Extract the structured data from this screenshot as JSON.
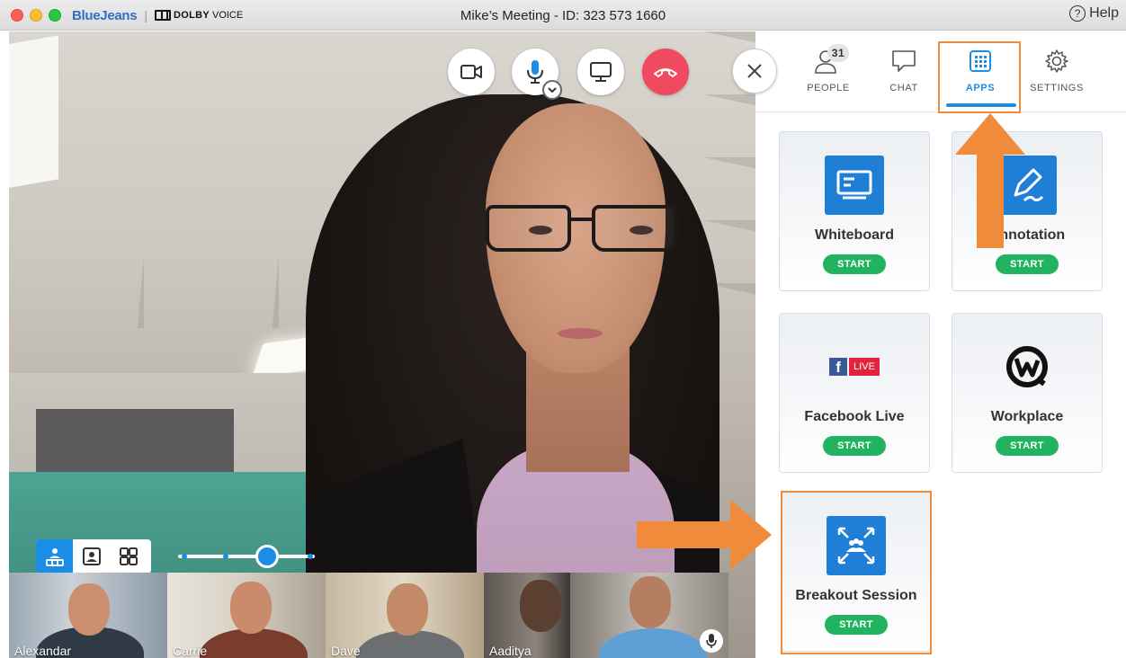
{
  "window": {
    "brand": "BlueJeans",
    "separator": "|",
    "dolby": "DOLBY",
    "dolby_voice": "VOICE",
    "title": "Mike’s Meeting - ID: 323 573 1660",
    "help_label": "Help"
  },
  "controls": {
    "video_icon": "video-camera-icon",
    "mic_icon": "microphone-icon",
    "share_icon": "screen-share-icon",
    "hangup_icon": "hang-up-icon",
    "close_icon": "close-icon"
  },
  "tabs": {
    "people_label": "PEOPLE",
    "people_count": "31",
    "chat_label": "CHAT",
    "apps_label": "APPS",
    "settings_label": "SETTINGS"
  },
  "apps": [
    {
      "title": "Whiteboard",
      "button": "START",
      "icon": "whiteboard-icon"
    },
    {
      "title": "Annotation",
      "button": "START",
      "icon": "annotation-icon"
    },
    {
      "title": "Facebook Live",
      "button": "START",
      "icon": "facebook-live-icon",
      "live_tag": "LIVE"
    },
    {
      "title": "Workplace",
      "button": "START",
      "icon": "workplace-icon"
    },
    {
      "title": "Breakout Session",
      "button": "START",
      "icon": "breakout-session-icon"
    }
  ],
  "participants": [
    {
      "name": "Alexandar"
    },
    {
      "name": "Carrie"
    },
    {
      "name": "Dave"
    },
    {
      "name": "Aaditya"
    },
    {
      "name": ""
    }
  ],
  "colors": {
    "accent": "#1a8ee6",
    "start_green": "#21b35f",
    "hangup_red": "#ef4a5f",
    "highlight_orange": "#ef8b3a"
  }
}
